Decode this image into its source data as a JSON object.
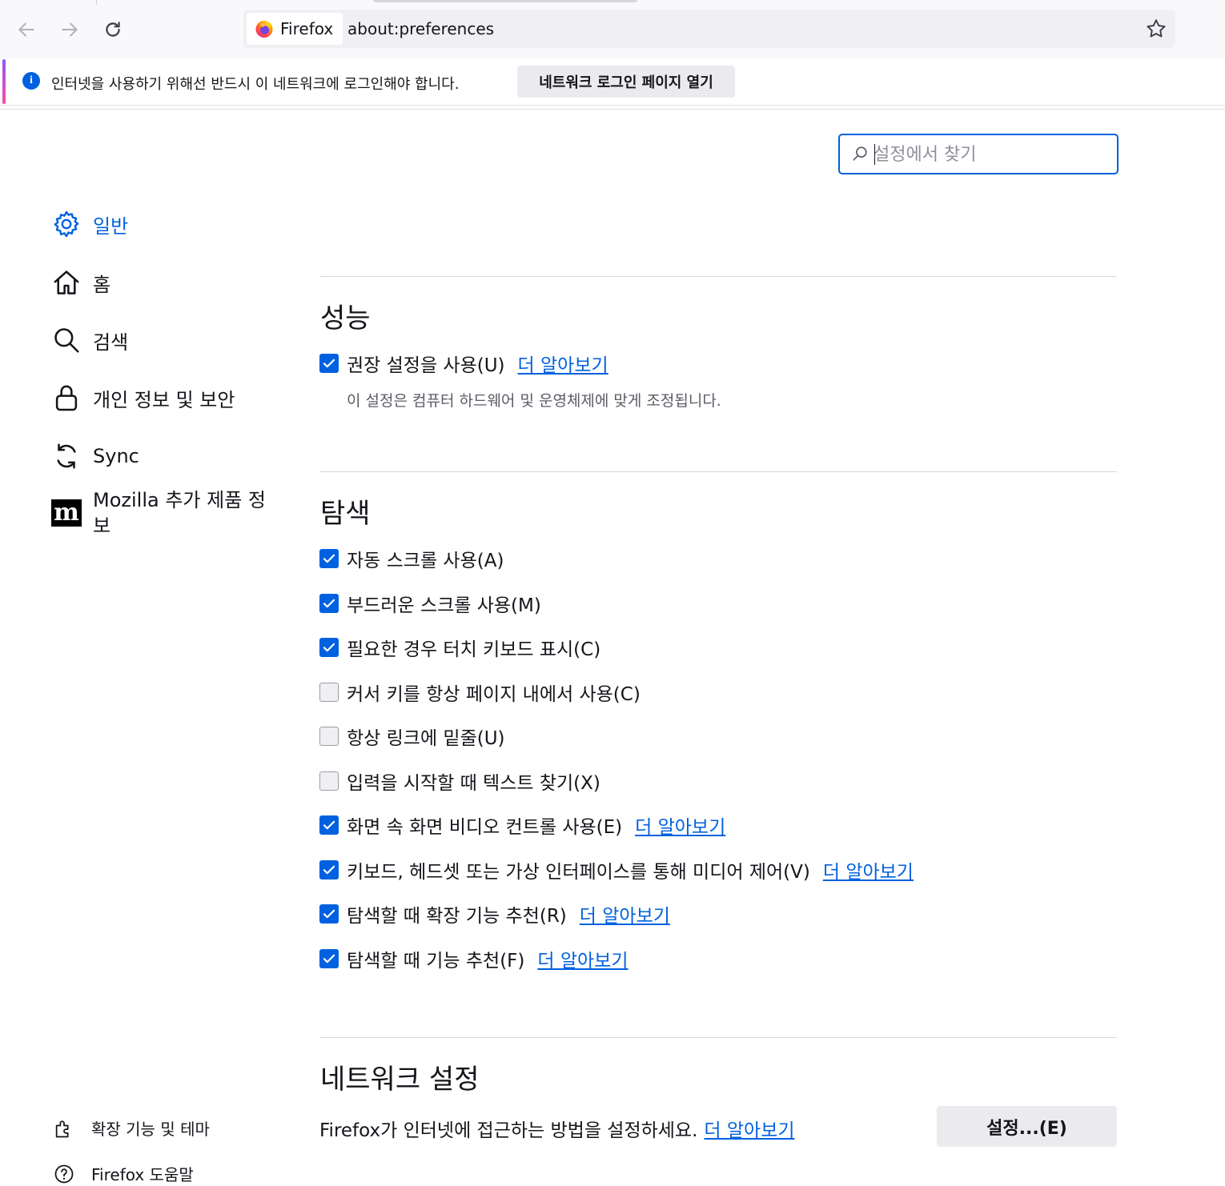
{
  "browser": {
    "identity_label": "Firefox",
    "url": "about:preferences"
  },
  "notification": {
    "message": "인터넷을 사용하기 위해선 반드시 이 네트워크에 로그인해야 합니다.",
    "button_label": "네트워크 로그인 페이지 열기"
  },
  "search": {
    "placeholder": "설정에서 찾기"
  },
  "sidebar": {
    "categories": [
      {
        "label": "일반",
        "icon": "gear-icon",
        "selected": true
      },
      {
        "label": "홈",
        "icon": "home-icon"
      },
      {
        "label": "검색",
        "icon": "search-icon"
      },
      {
        "label": "개인 정보 및 보안",
        "icon": "lock-icon"
      },
      {
        "label": "Sync",
        "icon": "sync-icon"
      },
      {
        "label": "Mozilla 추가 제품 정보",
        "icon": "mozilla-logo-icon"
      }
    ],
    "footer": {
      "extensions_label": "확장 기능 및 테마",
      "help_label": "Firefox 도움말"
    }
  },
  "performance": {
    "heading": "성능",
    "recommended_label": "권장 설정을 사용(U)",
    "recommended_checked": true,
    "learn_more": "더 알아보기",
    "description": "이 설정은 컴퓨터 하드웨어 및 운영체제에 맞게 조정됩니다."
  },
  "browsing": {
    "heading": "탐색",
    "options": [
      {
        "label": "자동 스크롤 사용(A)",
        "checked": true
      },
      {
        "label": "부드러운 스크롤 사용(M)",
        "checked": true
      },
      {
        "label": "필요한 경우 터치 키보드 표시(C)",
        "checked": true
      },
      {
        "label": "커서 키를 항상 페이지 내에서 사용(C)",
        "checked": false
      },
      {
        "label": "항상 링크에 밑줄(U)",
        "checked": false
      },
      {
        "label": "입력을 시작할 때 텍스트 찾기(X)",
        "checked": false
      },
      {
        "label": "화면 속 화면 비디오 컨트롤 사용(E)",
        "checked": true,
        "link": "더 알아보기"
      },
      {
        "label": "키보드, 헤드셋 또는 가상 인터페이스를 통해 미디어 제어(V)",
        "checked": true,
        "link": "더 알아보기"
      },
      {
        "label": "탐색할 때 확장 기능 추천(R)",
        "checked": true,
        "link": "더 알아보기"
      },
      {
        "label": "탐색할 때 기능 추천(F)",
        "checked": true,
        "link": "더 알아보기"
      }
    ]
  },
  "network": {
    "heading": "네트워크 설정",
    "description": "Firefox가 인터넷에 접근하는 방법을 설정하세요.",
    "learn_more": "더 알아보기",
    "button_label": "설정...(E)"
  },
  "colors": {
    "accent": "#0061e0",
    "notification_info": "#0060df"
  }
}
